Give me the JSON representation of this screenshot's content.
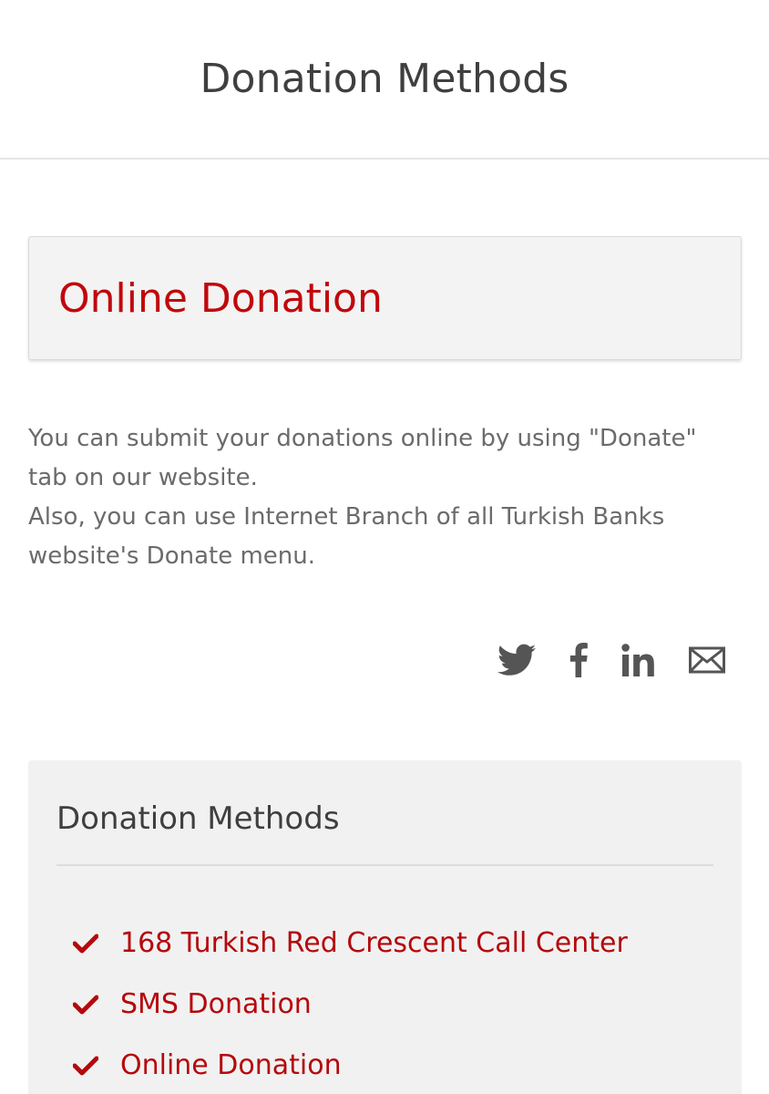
{
  "header": {
    "title": "Donation Methods"
  },
  "article": {
    "title": "Online Donation",
    "paragraphs": [
      "You can submit your donations online by using \"Donate\" tab on our website.",
      "Also, you can use Internet Branch of all Turkish Banks website's Donate menu."
    ]
  },
  "share": {
    "icons": [
      "twitter-icon",
      "facebook-icon",
      "linkedin-icon",
      "email-icon"
    ]
  },
  "methods": {
    "title": "Donation Methods",
    "items": [
      "168 Turkish Red Crescent Call Center",
      "SMS Donation",
      "Online Donation"
    ]
  },
  "colors": {
    "accent_red": "#c0080c",
    "heading_gray": "#3f3f3f",
    "body_gray": "#6b6b6b",
    "icon_gray": "#555555",
    "panel_bg": "#f1f1f1"
  }
}
